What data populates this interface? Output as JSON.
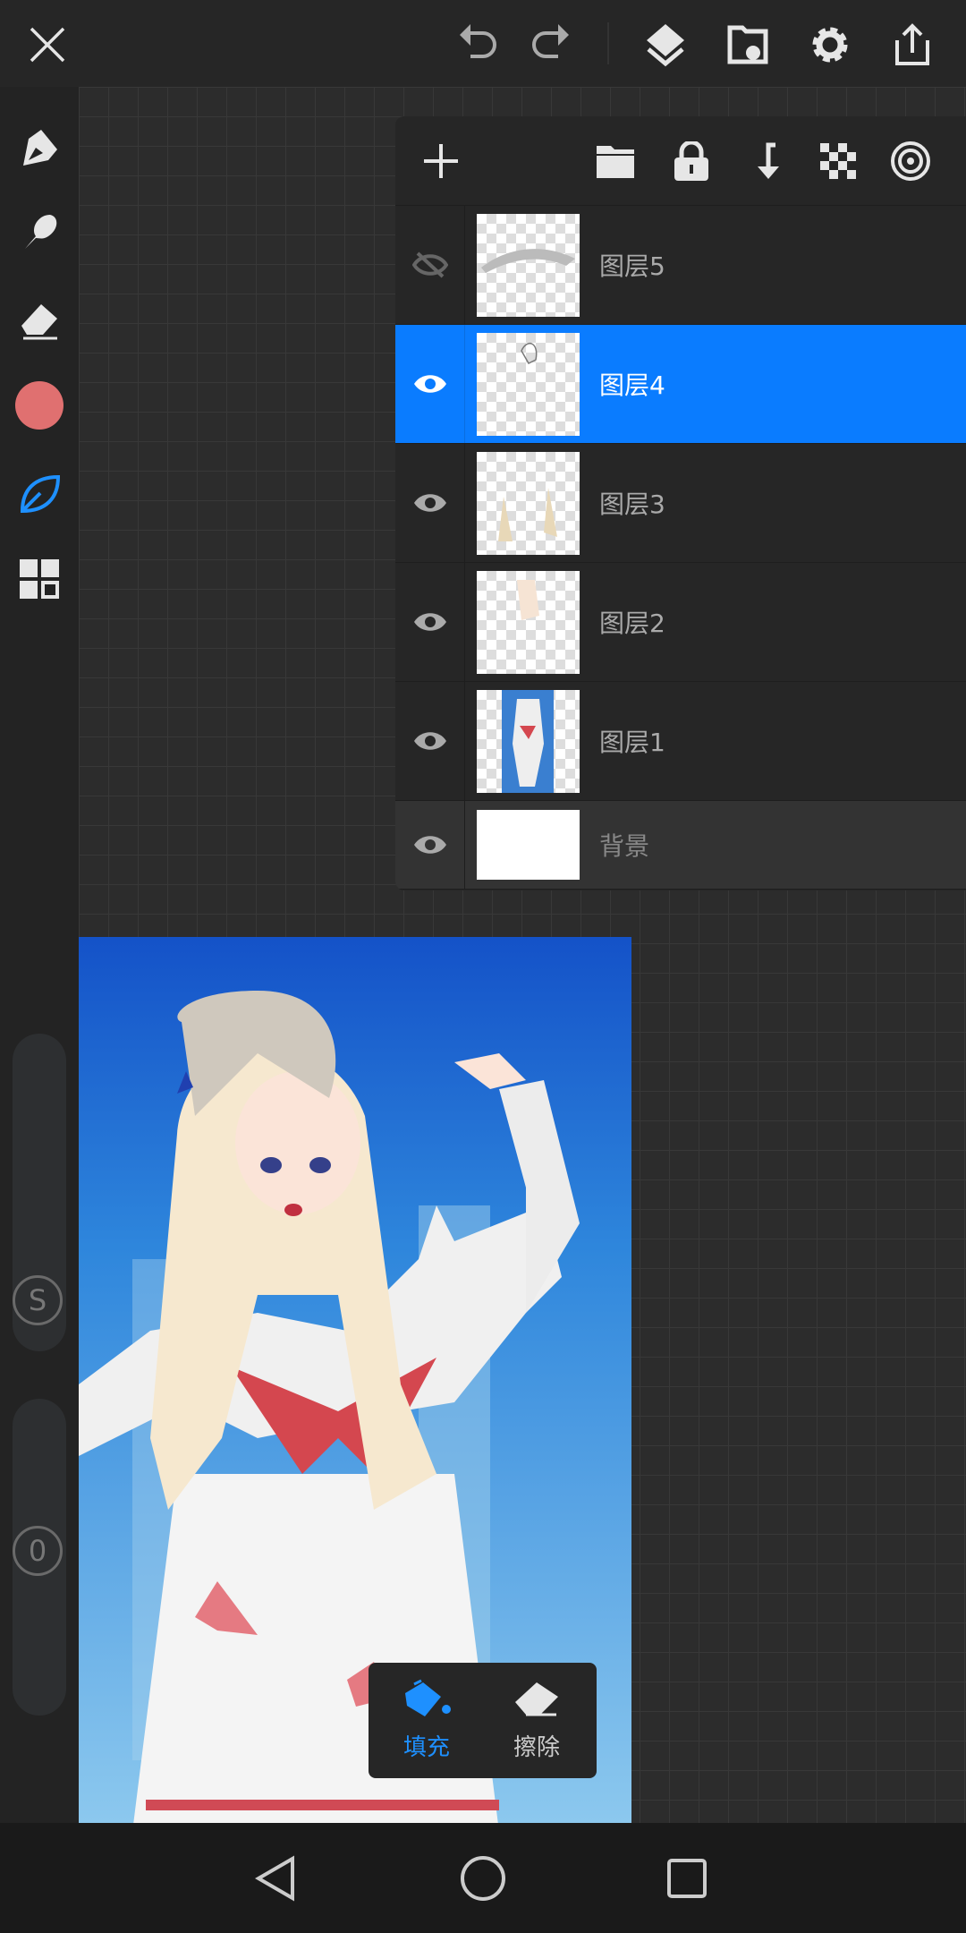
{
  "top_bar": {
    "icons": [
      "close-icon",
      "undo-icon",
      "redo-icon",
      "layers-icon",
      "import-file-icon",
      "settings-icon",
      "share-icon"
    ]
  },
  "left_tools": {
    "icons": [
      "pen-icon",
      "brush-icon",
      "eraser-icon",
      "color-swatch",
      "smudge-leaf-icon",
      "grid-apps-icon"
    ],
    "current_color": "#e07070",
    "active_color": "#1e90ff",
    "size_slider_label": "S",
    "opacity_slider_label": "0"
  },
  "layers_panel": {
    "header_icons": [
      "add-layer-icon",
      "folder-icon",
      "lock-icon",
      "merge-down-icon",
      "transparency-icon",
      "target-icon"
    ],
    "layers": [
      {
        "name": "图层5",
        "visible": false,
        "selected": false
      },
      {
        "name": "图层4",
        "visible": true,
        "selected": true
      },
      {
        "name": "图层3",
        "visible": true,
        "selected": false
      },
      {
        "name": "图层2",
        "visible": true,
        "selected": false
      },
      {
        "name": "图层1",
        "visible": true,
        "selected": false
      }
    ],
    "background": {
      "name": "背景",
      "visible": true
    }
  },
  "popup": {
    "fill_label": "填充",
    "erase_label": "擦除",
    "accent": "#1e90ff"
  },
  "colors": {
    "selected_row": "#0a7cff"
  }
}
